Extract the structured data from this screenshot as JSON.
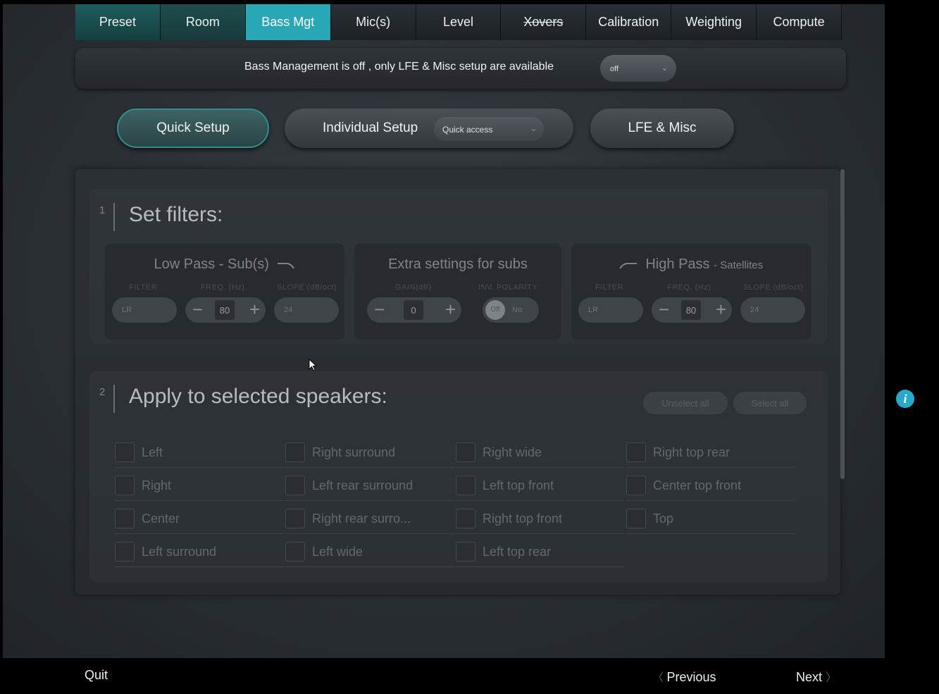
{
  "tabs": [
    "Preset",
    "Room",
    "Bass Mgt",
    "Mic(s)",
    "Level",
    "Xovers",
    "Calibration",
    "Weighting",
    "Compute"
  ],
  "active_tab": "Bass Mgt",
  "notice": {
    "text": "Bass Management is off , only LFE & Misc setup are available",
    "select_value": "off"
  },
  "setup_buttons": {
    "quick": "Quick Setup",
    "individual": "Individual Setup",
    "quick_access": "Quick access",
    "lfe": "LFE & Misc"
  },
  "filters": {
    "number": "1",
    "title": "Set filters:",
    "low_pass": {
      "title": "Low Pass - Sub(s)",
      "filter_label": "FILTER",
      "freq_label": "FREQ. (Hz)",
      "slope_label": "SLOPE (dB/oct)",
      "filter_value": "LR",
      "freq_value": "80",
      "slope_value": "24"
    },
    "extra": {
      "title": "Extra settings for subs",
      "gain_label": "GAIN(dB)",
      "polarity_label": "INV. POLARITY",
      "gain_value": "0",
      "polarity_knob": "Off",
      "polarity_value": "No"
    },
    "high_pass": {
      "title": "High Pass",
      "subtitle": "Satellites",
      "filter_label": "FILTER",
      "freq_label": "FREQ. (Hz)",
      "slope_label": "SLOPE (dB/oct)",
      "filter_value": "LR",
      "freq_value": "80",
      "slope_value": "24"
    }
  },
  "speakers": {
    "number": "2",
    "title": "Apply to selected speakers:",
    "unselect_all": "Unselect all",
    "select_all": "Select all",
    "columns": [
      [
        "Left",
        "Right",
        "Center",
        "Left surround"
      ],
      [
        "Right surround",
        "Left rear surround",
        "Right rear surro...",
        "Left wide"
      ],
      [
        "Right wide",
        "Left top front",
        "Right top front",
        "Left top rear"
      ],
      [
        "Right top rear",
        "Center top front",
        "Top"
      ]
    ]
  },
  "footer": {
    "quit": "Quit",
    "previous": "Previous",
    "next": "Next"
  },
  "colors": {
    "accent": "#2aa7b6",
    "info": "#29a9c9"
  }
}
